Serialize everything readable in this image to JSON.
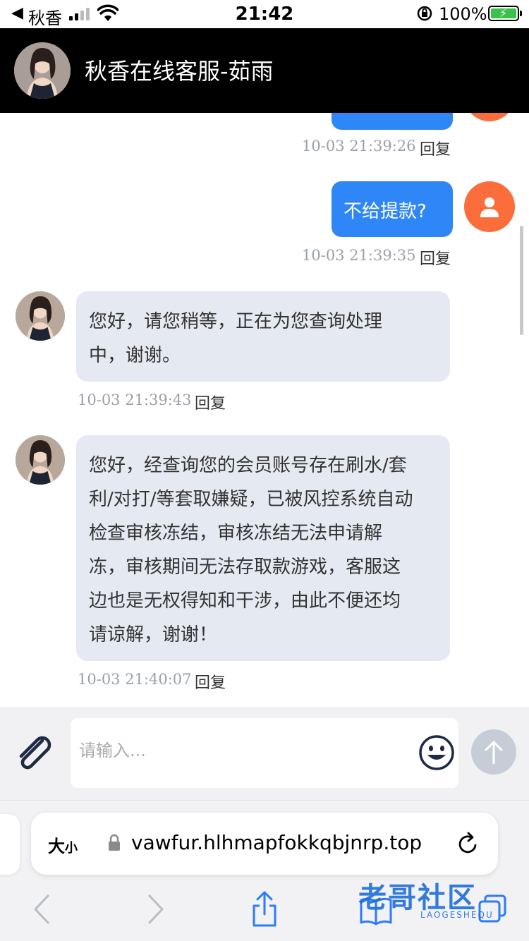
{
  "status_bar": {
    "back_label": "秋香",
    "time": "21:42",
    "battery": "100%"
  },
  "header": {
    "title": "秋香在线客服-茹雨"
  },
  "messages": [
    {
      "side": "right",
      "text": "",
      "time": "10-03 21:39:26",
      "reply": "回复"
    },
    {
      "side": "right",
      "text": "不给提款?",
      "time": "10-03 21:39:35",
      "reply": "回复"
    },
    {
      "side": "left",
      "lines": [
        "您好，请您稍等，正在为您查询处理",
        "中，谢谢。"
      ],
      "time": "10-03 21:39:43",
      "reply": "回复"
    },
    {
      "side": "left",
      "lines": [
        "您好，经查询您的会员账号存在刷水/套",
        "利/对打/等套取嫌疑，已被风控系统自动",
        "检查审核冻结，审核冻结无法申请解",
        "冻，审核期间无法存取款游戏，客服这",
        "边也是无权得知和干涉，由此不便还均",
        "请谅解，谢谢！"
      ],
      "time": "10-03 21:40:07",
      "reply": "回复"
    }
  ],
  "input": {
    "placeholder": "请输入..."
  },
  "browser": {
    "size_label_big": "大",
    "size_label_small": "小",
    "url": "vawfur.hlhmapfokkqbjnrp.top"
  },
  "watermark": {
    "text": "老哥社区",
    "sub": "LAOGESHEQU"
  },
  "colors": {
    "header_bg": "#000000",
    "user_bubble": "#2f86f6",
    "user_avatar": "#fb6d3a",
    "agent_bubble": "#e5e9f1"
  }
}
